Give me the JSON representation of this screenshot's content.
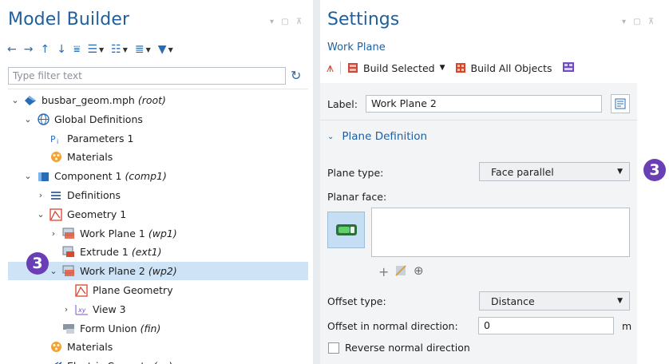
{
  "model_builder": {
    "title": "Model Builder",
    "filter_placeholder": "Type filter text",
    "tree": [
      {
        "label": "busbar_geom.mph",
        "tag": "(root)",
        "icon": "model-file-icon",
        "indent": 0,
        "expander": "expanded"
      },
      {
        "label": "Global Definitions",
        "tag": "",
        "icon": "globe-icon",
        "indent": 1,
        "expander": "expanded"
      },
      {
        "label": "Parameters 1",
        "tag": "",
        "icon": "parameters-icon",
        "indent": 2,
        "expander": "none"
      },
      {
        "label": "Materials",
        "tag": "",
        "icon": "materials-icon",
        "indent": 2,
        "expander": "none"
      },
      {
        "label": "Component 1",
        "tag": "(comp1)",
        "icon": "component-icon",
        "indent": 1,
        "expander": "expanded"
      },
      {
        "label": "Definitions",
        "tag": "",
        "icon": "definitions-icon",
        "indent": 2,
        "expander": "collapsed"
      },
      {
        "label": "Geometry 1",
        "tag": "",
        "icon": "geometry-icon",
        "indent": 2,
        "expander": "expanded"
      },
      {
        "label": "Work Plane 1",
        "tag": "(wp1)",
        "icon": "work-plane-icon",
        "indent": 3,
        "expander": "collapsed"
      },
      {
        "label": "Extrude 1",
        "tag": "(ext1)",
        "icon": "extrude-icon",
        "indent": 3,
        "expander": "none"
      },
      {
        "label": "Work Plane 2",
        "tag": "(wp2)",
        "icon": "work-plane-icon",
        "indent": 3,
        "expander": "expanded",
        "selected": true
      },
      {
        "label": "Plane Geometry",
        "tag": "",
        "icon": "plane-geometry-icon",
        "indent": 4,
        "expander": "none"
      },
      {
        "label": "View 3",
        "tag": "",
        "icon": "view-icon",
        "indent": 4,
        "expander": "collapsed"
      },
      {
        "label": "Form Union",
        "tag": "(fin)",
        "icon": "form-union-icon",
        "indent": 3,
        "expander": "none"
      },
      {
        "label": "Materials",
        "tag": "",
        "icon": "materials-icon",
        "indent": 2,
        "expander": "none"
      },
      {
        "label": "Electric Currents",
        "tag": "(ec)",
        "icon": "electric-currents-icon",
        "indent": 2,
        "expander": "collapsed"
      }
    ],
    "badge": "3"
  },
  "settings": {
    "title": "Settings",
    "subtitle": "Work Plane",
    "build_selected": "Build Selected",
    "build_all": "Build All Objects",
    "label_caption": "Label:",
    "label_value": "Work Plane 2",
    "section": "Plane Definition",
    "plane_type_caption": "Plane type:",
    "plane_type_value": "Face parallel",
    "planar_face_caption": "Planar face:",
    "offset_type_caption": "Offset type:",
    "offset_type_value": "Distance",
    "offset_normal_caption": "Offset in normal direction:",
    "offset_normal_value": "0",
    "offset_unit": "m",
    "reverse_caption": "Reverse normal direction",
    "badge": "3"
  },
  "colors": {
    "title_blue": "#1f5f9e",
    "selection": "#cfe3f7",
    "badge": "#6a3fb5"
  }
}
